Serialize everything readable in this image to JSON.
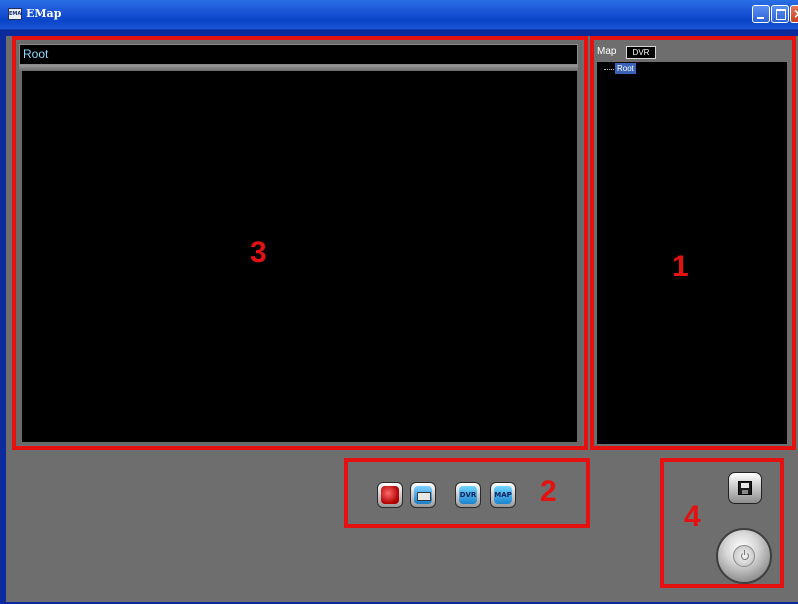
{
  "window": {
    "title": "EMap",
    "app_icon_text": "EMAP",
    "controls": [
      "minimize",
      "maximize",
      "close"
    ]
  },
  "map_view": {
    "header_label": "Root"
  },
  "tree_panel": {
    "tabs": [
      {
        "label": "Map",
        "active": true
      },
      {
        "label": "DVR",
        "active": false
      }
    ],
    "nodes": [
      {
        "label": "Root",
        "selected": true
      }
    ]
  },
  "toolbar": {
    "buttons": [
      {
        "name": "alarm",
        "icon": "alarm-icon",
        "label": ""
      },
      {
        "name": "camera",
        "icon": "camera-icon",
        "label": ""
      },
      {
        "name": "dvr",
        "icon": "dvr-icon",
        "label": "DVR"
      },
      {
        "name": "map",
        "icon": "map-icon",
        "label": "MAP"
      }
    ]
  },
  "actions": {
    "save_icon": "save-icon",
    "power_icon": "power-icon"
  },
  "annotations": [
    "1",
    "2",
    "3",
    "4"
  ],
  "colors": {
    "annotation": "#e51010",
    "titlebar": "#1a55d6",
    "panel": "#6e6e6e",
    "canvas": "#000000",
    "header_text": "#8fd8ff"
  }
}
